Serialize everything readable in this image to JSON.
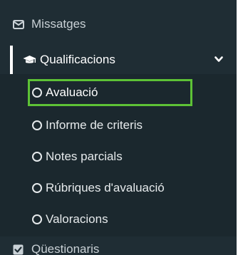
{
  "sidebar": {
    "items_top": [
      {
        "label": "Missatges",
        "icon": "envelope-icon"
      }
    ],
    "group": {
      "label": "Qualificacions",
      "icon": "graduation-cap-icon",
      "expanded": true,
      "chevron": "chevron-down-icon"
    },
    "submenu": [
      {
        "label": "Avaluació",
        "active": true
      },
      {
        "label": "Informe de criteris",
        "active": false
      },
      {
        "label": "Notes parcials",
        "active": false
      },
      {
        "label": "Rúbriques d'avaluació",
        "active": false
      },
      {
        "label": "Valoracions",
        "active": false
      }
    ],
    "items_bottom": [
      {
        "label": "Qüestionaris",
        "icon": "checkbox-icon"
      }
    ]
  },
  "colors": {
    "sidebar_bg": "#1f2d34",
    "submenu_bg": "#1b282e",
    "highlight_border": "#5dc236",
    "text": "#e6eaec"
  }
}
